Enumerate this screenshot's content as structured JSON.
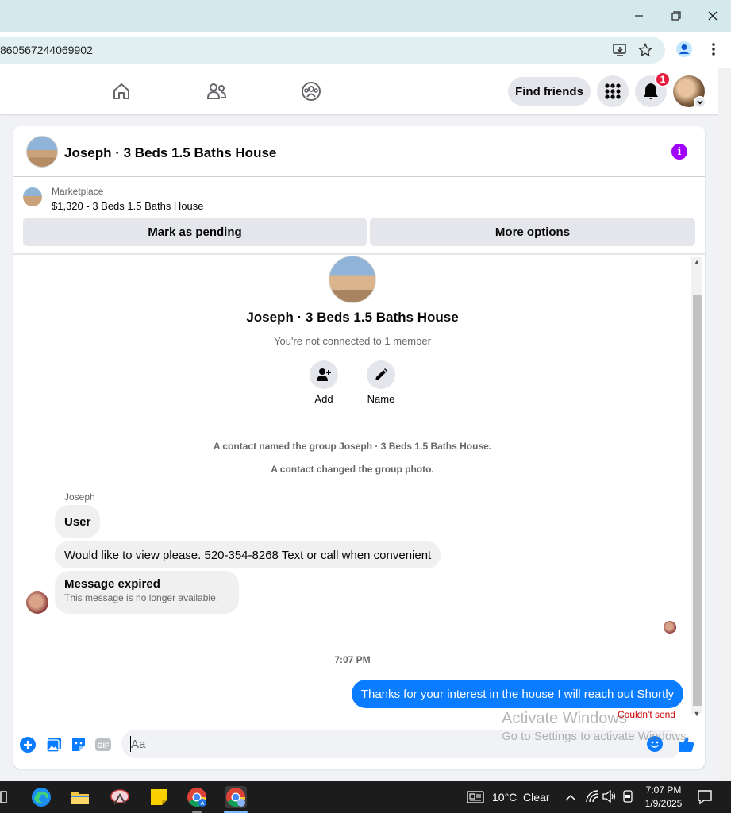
{
  "browser": {
    "url": "860567244069902",
    "icons": [
      "minimize-icon",
      "restore-icon",
      "close-icon",
      "install-app-icon",
      "bookmark-star-icon",
      "profile-icon",
      "menu-dots-icon"
    ]
  },
  "header": {
    "nav_icons": [
      "home-icon",
      "friends-icon",
      "groups-icon"
    ],
    "find_friends_label": "Find friends",
    "notification_count": "1"
  },
  "chat": {
    "title": "Joseph · 3 Beds 1.5 Baths House",
    "marketplace_label": "Marketplace",
    "listing_title": "$1,320 - 3 Beds 1.5 Baths House",
    "mark_pending_label": "Mark as pending",
    "more_options_label": "More options",
    "group_name": "Joseph · 3 Beds 1.5 Baths House",
    "not_connected": "You're not connected to 1 member",
    "add_label": "Add",
    "name_label": "Name",
    "system_messages": [
      "A contact named the group Joseph · 3 Beds 1.5 Baths House.",
      "A contact changed the group photo."
    ],
    "sender_name": "Joseph",
    "incoming_messages": [
      "User",
      "Would like to view please. 520-354-8268 Text or call when convenient"
    ],
    "expired_title": "Message expired",
    "expired_subtitle": "This message is no longer available.",
    "timestamp": "7:07 PM",
    "outgoing_message": "Thanks for your interest in the house I will reach out Shortly",
    "outgoing_status": "Couldn't send",
    "composer_placeholder": "Aa",
    "accent_color": "#0a7cff"
  },
  "watermark": {
    "line1": "Activate Windows",
    "line2": "Go to Settings to activate Windows."
  },
  "taskbar": {
    "weather": "10°C  Clear",
    "time": "7:07 PM",
    "date": "1/9/2025"
  }
}
